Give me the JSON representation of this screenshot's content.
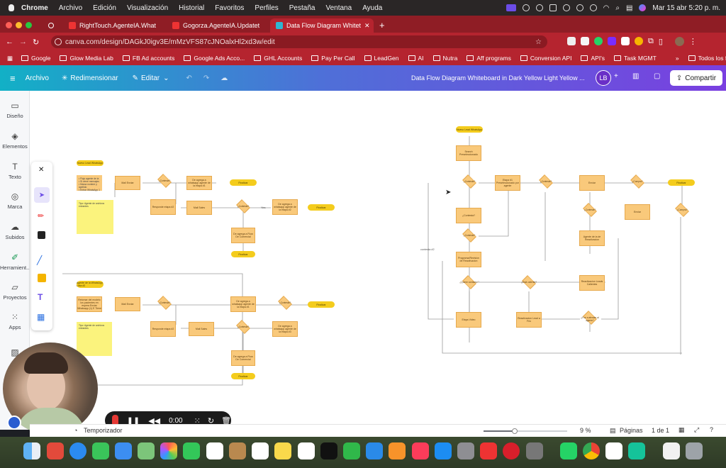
{
  "mac_menu": {
    "apple": "",
    "app": "Chrome",
    "items": [
      "Archivo",
      "Edición",
      "Visualización",
      "Historial",
      "Favoritos",
      "Perfiles",
      "Pestaña",
      "Ventana",
      "Ayuda"
    ],
    "clock": "Mar 15 abr  5:20 p. m."
  },
  "tabs": [
    {
      "title": "RightTouch.AgenteIA.What",
      "favicon_color": "#e33"
    },
    {
      "title": "Gogorza.AgenteIA.Updatet",
      "favicon_color": "#e33"
    },
    {
      "title": "Data Flow Diagram Whitet",
      "favicon_color": "#2fb5d1",
      "active": true
    }
  ],
  "address": {
    "url": "canva.com/design/DAGkJ0igv3E/mMzVFS87cJNOalxHl2xd3w/edit"
  },
  "bookmarks": [
    "Google",
    "Glow Media Lab",
    "FB Ad accounts",
    "Google Ads Acco...",
    "GHL Accounts",
    "Pay Per Call",
    "LeadGen",
    "AI",
    "Nutra",
    "Aff programs",
    "Conversion API",
    "API's",
    "Task MGMT"
  ],
  "bookmarks_more": "»",
  "bookmarks_all": "Todos los favoritos",
  "canva_header": {
    "file": "Archivo",
    "resize": "Redimensionar",
    "edit": "Editar",
    "title": "Data Flow Diagram Whiteboard in Dark Yellow Light Yellow ...",
    "avatar": "LB",
    "share": "Compartir"
  },
  "left_rail": [
    {
      "label": "Diseño",
      "icon": "layout-icon"
    },
    {
      "label": "Elementos",
      "icon": "shapes-icon"
    },
    {
      "label": "Texto",
      "icon": "text-icon"
    },
    {
      "label": "Marca",
      "icon": "brand-icon"
    },
    {
      "label": "Subidos",
      "icon": "upload-icon"
    },
    {
      "label": "Herramient...",
      "icon": "tools-icon"
    },
    {
      "label": "Proyectos",
      "icon": "folder-icon"
    },
    {
      "label": "Apps",
      "icon": "apps-icon"
    }
  ],
  "left_flow": {
    "start": "Nuevo Lead WhatsApp",
    "sticky_top": "• Flujo agente de ia\n• Si viene mensajes\n• Marca nombre y apellido\n• Entrar WhatsApp 1",
    "sticky_note": "Tipo: Agente de archivos entrantes",
    "nodes": [
      "Mail Enviar",
      "De agrega a whatsapp agente de ia etapa #1",
      "Responde etapa #2",
      "Mail Sales",
      "De agrega a whatsapp agente de ia etapa #2",
      "De agrega a Flow De Comercial",
      "Etapa #1",
      "Etapa #2"
    ],
    "decisions": [
      "¿Contesta?",
      "¿Contesta?"
    ],
    "pills": [
      "Finalizar",
      "Finalizar",
      "Finalizar"
    ],
    "yes": "Yes",
    "no": "No"
  },
  "left_flow2": {
    "start": "Agente de ia WhatsApp Lista #2",
    "sticky_top": "Retomar del modelo los pacientes en espera Enviar Whatsapp (1) E Tiene",
    "sticky_note": "Tipo: Agente de archivos entrantes",
    "nodes": [
      "Mail Enviar",
      "De agrega a whatsapp agente de ia etapa #1",
      "Responde etapa #2",
      "Mail Sales",
      "De agrega a whatsapp agente de ia etapa #3",
      "De agrega a Flow De Comercial"
    ],
    "pills": [
      "Finalizar",
      "Finalizar"
    ]
  },
  "right_flow": {
    "start": "Nuevo Lead WhatsApp",
    "nodes": [
      "Search Preseleccionado",
      "Etapa #1 Preseleccionado por agente",
      "Enviar",
      "Enviar",
      "Agente de ia de Reactivacion",
      "Programa/Revision de Reactivacion",
      "Etapa Video",
      "Reactivacion Lead a Frio",
      "Reactivacion Leads Calientes",
      "Etapa #2"
    ],
    "decisions": [
      "¿Contesta?",
      "¿Contesta?",
      "¿Compra?",
      "¿Contesta?",
      "¿Contesta?",
      "¿Compra?",
      "¿Quiere contactar?",
      "¿Está caliente?",
      "¿Fue a atender al agente?"
    ],
    "pills": [
      "Finalizar"
    ],
    "side_label": "contesta #2"
  },
  "recorder": {
    "time": "0:00"
  },
  "bottom": {
    "timer": "Temporizador",
    "zoom": "9 %",
    "pages_label": "Páginas",
    "pages": "1 de 1"
  }
}
